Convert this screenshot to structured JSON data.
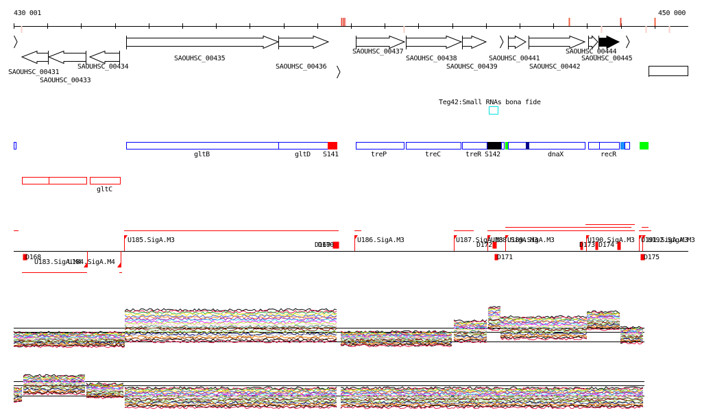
{
  "ruler": {
    "start_label": "430 001",
    "end_label": "450 000"
  },
  "cds_labels": [
    "SAOUHSC_00431",
    "SAOUHSC_00433",
    "SAOUHSC_00434",
    "SAOUHSC_00435",
    "SAOUHSC_00436",
    "SAOUHSC_00437",
    "SAOUHSC_00438",
    "SAOUHSC_00439",
    "SAOUHSC_00441",
    "SAOUHSC_00442",
    "SAOUHSC_00444",
    "SAOUHSC_00445"
  ],
  "srna_label": "Teg42:Small RNAs bona fide",
  "genes": [
    "gltB",
    "gltD",
    "S141",
    "treP",
    "treC",
    "treR",
    "S142",
    "dnaX",
    "recR",
    "gltC"
  ],
  "operon_labels": [
    "U185.SigA.M3",
    "U186.SigA.M3",
    "U187.SigA.M3",
    "U188.SigA.M3",
    "U189.SigA.M3",
    "U190.SigA.M3",
    "U191.SigA.M3",
    "U192.SigA.M3",
    "U183.SigA.M4",
    "U184.SigA.M4"
  ],
  "dsites": [
    "D168",
    "D169",
    "D170",
    "D171",
    "D172",
    "D173",
    "D174",
    "D175"
  ],
  "colors": {
    "red": "#ff0000",
    "blue": "#0000ff",
    "cyan": "#00e0e0",
    "green": "#00ff00",
    "lightblue": "#1e90ff",
    "darkblue": "#00008b"
  }
}
